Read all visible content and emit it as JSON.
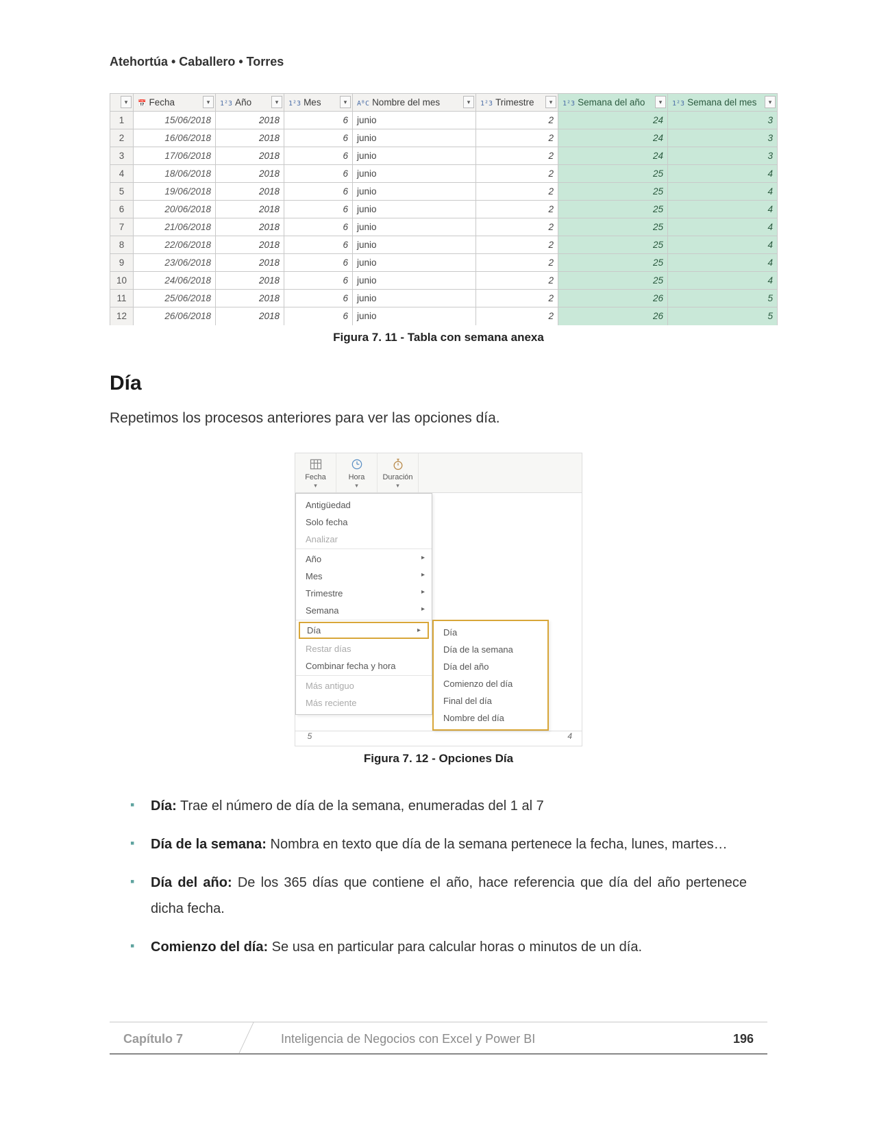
{
  "authors": "Atehortúa • Caballero • Torres",
  "table": {
    "columns": [
      {
        "icon": "📅",
        "label": "Fecha"
      },
      {
        "icon": "1²3",
        "label": "Año"
      },
      {
        "icon": "1²3",
        "label": "Mes"
      },
      {
        "icon": "AᴮC",
        "label": "Nombre del mes"
      },
      {
        "icon": "1²3",
        "label": "Trimestre"
      },
      {
        "icon": "1²3",
        "label": "Semana del año",
        "green": true
      },
      {
        "icon": "1²3",
        "label": "Semana del mes",
        "green": true
      }
    ],
    "rows": [
      {
        "n": "1",
        "fecha": "15/06/2018",
        "ano": "2018",
        "mes": "6",
        "nombre": "junio",
        "tri": "2",
        "sano": "24",
        "smes": "3"
      },
      {
        "n": "2",
        "fecha": "16/06/2018",
        "ano": "2018",
        "mes": "6",
        "nombre": "junio",
        "tri": "2",
        "sano": "24",
        "smes": "3"
      },
      {
        "n": "3",
        "fecha": "17/06/2018",
        "ano": "2018",
        "mes": "6",
        "nombre": "junio",
        "tri": "2",
        "sano": "24",
        "smes": "3"
      },
      {
        "n": "4",
        "fecha": "18/06/2018",
        "ano": "2018",
        "mes": "6",
        "nombre": "junio",
        "tri": "2",
        "sano": "25",
        "smes": "4"
      },
      {
        "n": "5",
        "fecha": "19/06/2018",
        "ano": "2018",
        "mes": "6",
        "nombre": "junio",
        "tri": "2",
        "sano": "25",
        "smes": "4"
      },
      {
        "n": "6",
        "fecha": "20/06/2018",
        "ano": "2018",
        "mes": "6",
        "nombre": "junio",
        "tri": "2",
        "sano": "25",
        "smes": "4"
      },
      {
        "n": "7",
        "fecha": "21/06/2018",
        "ano": "2018",
        "mes": "6",
        "nombre": "junio",
        "tri": "2",
        "sano": "25",
        "smes": "4"
      },
      {
        "n": "8",
        "fecha": "22/06/2018",
        "ano": "2018",
        "mes": "6",
        "nombre": "junio",
        "tri": "2",
        "sano": "25",
        "smes": "4"
      },
      {
        "n": "9",
        "fecha": "23/06/2018",
        "ano": "2018",
        "mes": "6",
        "nombre": "junio",
        "tri": "2",
        "sano": "25",
        "smes": "4"
      },
      {
        "n": "10",
        "fecha": "24/06/2018",
        "ano": "2018",
        "mes": "6",
        "nombre": "junio",
        "tri": "2",
        "sano": "25",
        "smes": "4"
      },
      {
        "n": "11",
        "fecha": "25/06/2018",
        "ano": "2018",
        "mes": "6",
        "nombre": "junio",
        "tri": "2",
        "sano": "26",
        "smes": "5"
      },
      {
        "n": "12",
        "fecha": "26/06/2018",
        "ano": "2018",
        "mes": "6",
        "nombre": "junio",
        "tri": "2",
        "sano": "26",
        "smes": "5"
      }
    ]
  },
  "fig1_caption": "Figura 7. 11 - Tabla con semana anexa",
  "section_title": "Día",
  "para1": "Repetimos los procesos anteriores para ver las opciones día.",
  "menu": {
    "toolbar": [
      {
        "label": "Fecha",
        "icon": "grid"
      },
      {
        "label": "Hora",
        "icon": "clock"
      },
      {
        "label": "Duración",
        "icon": "stopwatch"
      }
    ],
    "items": [
      {
        "label": "Antigüedad"
      },
      {
        "label": "Solo fecha"
      },
      {
        "label": "Analizar",
        "disabled": true,
        "sep": true
      },
      {
        "label": "Año",
        "sub": true
      },
      {
        "label": "Mes",
        "sub": true
      },
      {
        "label": "Trimestre",
        "sub": true
      },
      {
        "label": "Semana",
        "sub": true,
        "sep": true
      },
      {
        "label": "Día",
        "sub": true,
        "highlight": true,
        "sep": true
      },
      {
        "label": "Restar días",
        "disabled": true
      },
      {
        "label": "Combinar fecha y hora",
        "sep": true
      },
      {
        "label": "Más antiguo",
        "disabled": true
      },
      {
        "label": "Más reciente",
        "disabled": true
      }
    ],
    "sub": [
      "Día",
      "Día de la semana",
      "Día del año",
      "Comienzo del día",
      "Final del día",
      "Nombre del día"
    ],
    "under_row": {
      "c1": "5",
      "c2": "4"
    }
  },
  "fig2_caption": "Figura 7. 12 - Opciones Día",
  "defs": [
    {
      "term": "Día:",
      "text": " Trae el número de día de la semana, enumeradas del 1 al 7"
    },
    {
      "term": "Día de la semana:",
      "text": " Nombra en texto que día de la semana pertenece la fecha, lunes, martes…"
    },
    {
      "term": "Día del año:",
      "text": " De los 365 días que contiene el año, hace referencia que día del año pertenece dicha fecha."
    },
    {
      "term": "Comienzo del día:",
      "text": " Se usa en particular para calcular horas o minutos de un día."
    }
  ],
  "footer": {
    "chapter": "Capítulo 7",
    "title": "Inteligencia de Negocios con Excel y Power BI",
    "page": "196"
  }
}
